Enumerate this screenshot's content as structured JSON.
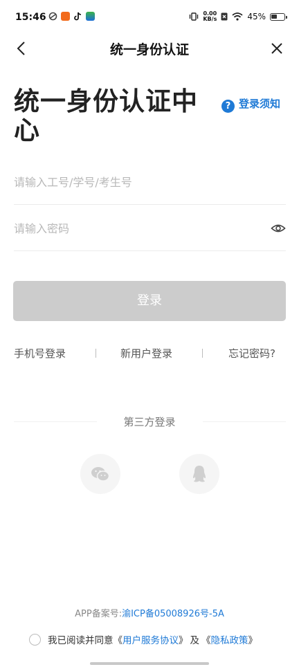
{
  "status_bar": {
    "time": "15:46",
    "net_speed_value": "0.00",
    "net_speed_unit": "KB/s",
    "battery": "45%"
  },
  "nav": {
    "title": "统一身份认证"
  },
  "heading": {
    "title": "统一身份认证中心",
    "notice_label": "登录须知",
    "notice_icon": "?"
  },
  "form": {
    "username_placeholder": "请输入工号/学号/考生号",
    "username_value": "",
    "password_placeholder": "请输入密码",
    "password_value": "",
    "login_label": "登录"
  },
  "links": {
    "phone_login": "手机号登录",
    "new_user_login": "新用户登录",
    "forgot_password": "忘记密码?"
  },
  "third_party": {
    "title": "第三方登录"
  },
  "footer": {
    "icp_label": "APP备案号:",
    "icp_number": "渝ICP备05008926号-5A",
    "agree_prefix": "我已阅读并同意",
    "open_quote_1": "《",
    "service_agreement": "用户服务协议",
    "close_quote_1": "》",
    "and": "及",
    "open_quote_2": "《",
    "privacy_policy": "隐私政策",
    "close_quote_2": "》"
  },
  "colors": {
    "accent": "#1f7ad6",
    "button_disabled": "#cccccc"
  }
}
